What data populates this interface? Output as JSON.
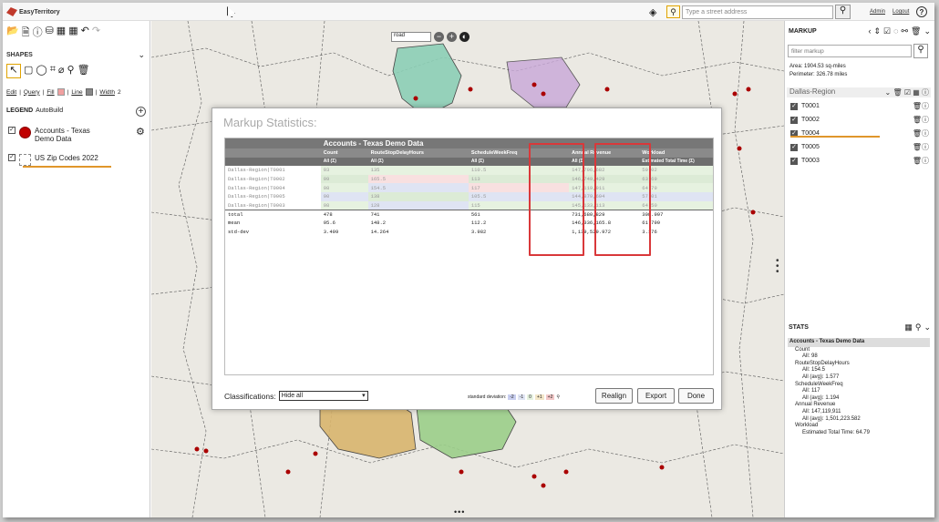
{
  "app": {
    "name": "EasyTerritory"
  },
  "topbar": {
    "search_placeholder": "Type a street address",
    "links": [
      "Admin",
      "Logout"
    ],
    "help": "?"
  },
  "left": {
    "shapes_header": "SHAPES",
    "links": {
      "edit": "Edit",
      "query": "Query",
      "fill": "Fill",
      "line": "Line",
      "width": "Width",
      "width_value": "2"
    },
    "legend_header": "LEGEND",
    "legend_autobuild": "AutoBuild",
    "legend_items": [
      "Accounts - Texas Demo Data",
      "US Zip Codes 2022"
    ]
  },
  "map": {
    "base_layer": "road"
  },
  "modal": {
    "title": "Markup Statistics:",
    "dataset": "Accounts - Texas Demo Data",
    "columns": [
      "Count",
      "RouteStopDelayHours",
      "ScheduleWeekFreq",
      "Annual Revenue",
      "Workload"
    ],
    "subcolumns": [
      "All (Σ)",
      "All (Σ)",
      "All (Σ)",
      "All (Σ)",
      "Estimated Total Time (Σ)"
    ],
    "rows": [
      {
        "name": "Dallas-Region|T0001",
        "v": [
          "93",
          "135",
          "110.5",
          "147,796,682",
          "59.02"
        ]
      },
      {
        "name": "Dallas-Region|T0002",
        "v": [
          "99",
          "165.5",
          "113",
          "146,749,429",
          "63.69"
        ]
      },
      {
        "name": "Dallas-Region|T0004",
        "v": [
          "98",
          "154.5",
          "117",
          "147,119,911",
          "64.79"
        ]
      },
      {
        "name": "Dallas-Region|T0005",
        "v": [
          "90",
          "138",
          "105.5",
          "144,879,694",
          "57.01"
        ]
      },
      {
        "name": "Dallas-Region|T0003",
        "v": [
          "98",
          "128",
          "115",
          "145,133,113",
          "64.50"
        ]
      }
    ],
    "summary": [
      {
        "name": "total",
        "v": [
          "478",
          "741",
          "561",
          "731,680,829",
          "308.997"
        ]
      },
      {
        "name": "mean",
        "v": [
          "95.6",
          "148.2",
          "112.2",
          "146,336,165.8",
          "61.799"
        ]
      },
      {
        "name": "std-dev",
        "v": [
          "3.499",
          "14.264",
          "3.982",
          "1,139,529.972",
          "3.176"
        ]
      }
    ],
    "classifications_label": "Classifications:",
    "classifications_value": "Hide all",
    "std_label": "standard deviation:",
    "std_buckets": [
      "-2",
      "-1",
      "0",
      "+1",
      "+2"
    ],
    "buttons": {
      "realign": "Realign",
      "export": "Export",
      "done": "Done"
    }
  },
  "right": {
    "markup_header": "MARKUP",
    "filter_placeholder": "filter markup",
    "area": "Area: 1904.53 sq-miles",
    "perimeter": "Perimeter: 326.78 miles",
    "region": "Dallas-Region",
    "territories": [
      "T0001",
      "T0002",
      "T0004",
      "T0005",
      "T0003"
    ],
    "stats_header": "STATS",
    "stats": [
      {
        "t": "Accounts - Texas Demo Data",
        "cls": "head"
      },
      {
        "t": "Count",
        "lvl": 1
      },
      {
        "t": "All: 98",
        "lvl": 2
      },
      {
        "t": "RouteStopDelayHours",
        "lvl": 1
      },
      {
        "t": "All: 154.5",
        "lvl": 2
      },
      {
        "t": "All (avg): 1.577",
        "lvl": 2
      },
      {
        "t": "ScheduleWeekFreq",
        "lvl": 1
      },
      {
        "t": "All: 117",
        "lvl": 2
      },
      {
        "t": "All (avg): 1.194",
        "lvl": 2
      },
      {
        "t": "Annual Revenue",
        "lvl": 1
      },
      {
        "t": "All: 147,119,911",
        "lvl": 2
      },
      {
        "t": "All (avg): 1,501,223.582",
        "lvl": 2
      },
      {
        "t": "Workload",
        "lvl": 1
      },
      {
        "t": "Estimated Total Time: 64.79",
        "lvl": 2
      }
    ]
  }
}
